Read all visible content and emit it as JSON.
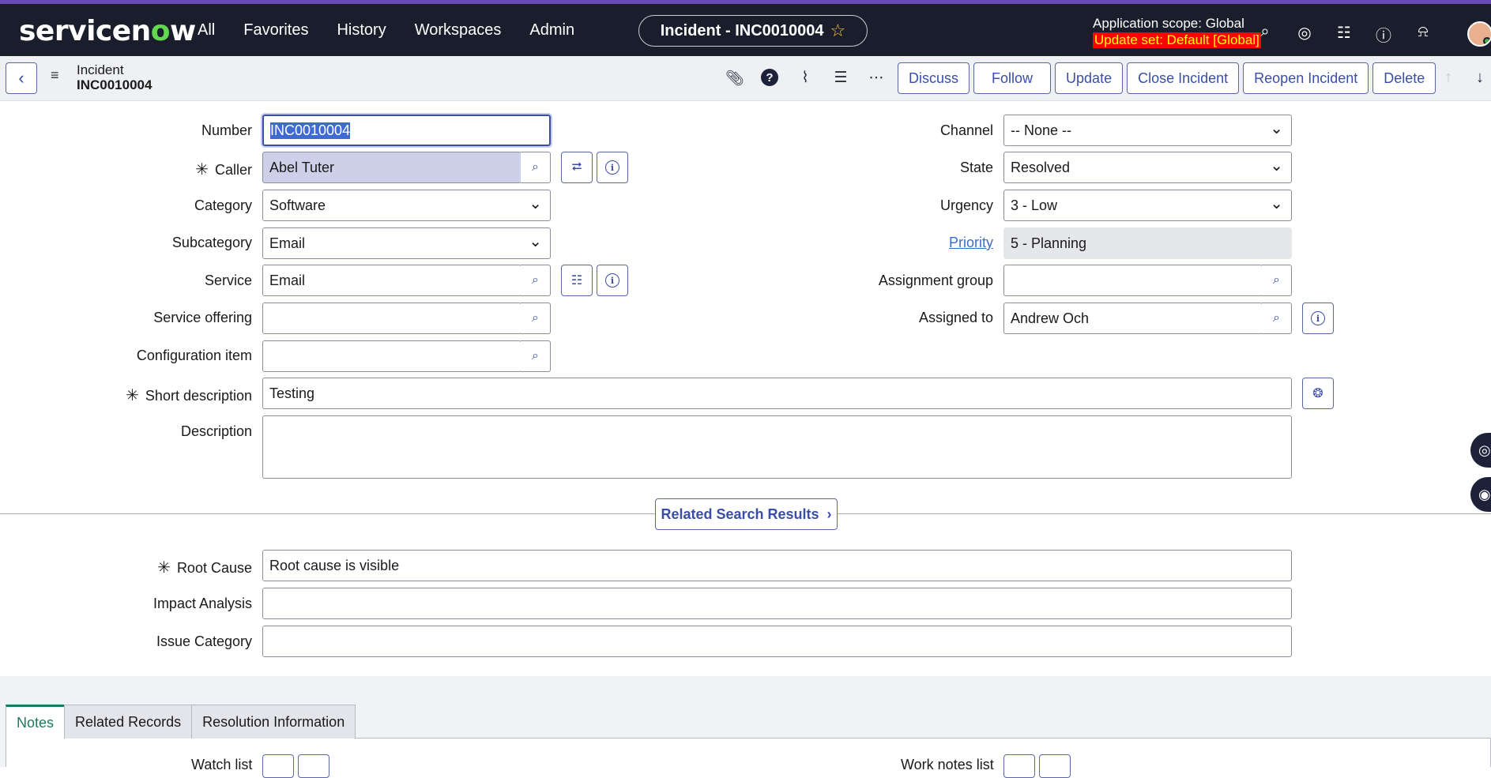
{
  "top_nav": {
    "logo_text_a": "servicen",
    "logo_text_o": "o",
    "logo_text_b": "w",
    "links": [
      "All",
      "Favorites",
      "History",
      "Workspaces",
      "Admin"
    ],
    "context_title": "Incident - INC0010004",
    "scope_line": "Application scope: Global",
    "update_set_line": "Update set: Default [Global]",
    "icons": [
      "search-icon",
      "globe-icon",
      "chat-icon",
      "help-icon",
      "bell-icon"
    ]
  },
  "form_header": {
    "table": "Incident",
    "number": "INC0010004",
    "icons": [
      "paperclip-icon",
      "help-icon",
      "activity-icon",
      "settings-sliders-icon",
      "more-icon"
    ],
    "buttons": [
      "Discuss",
      "Follow",
      "Update",
      "Close Incident",
      "Reopen Incident",
      "Delete"
    ]
  },
  "form": {
    "left": {
      "number": {
        "label": "Number",
        "value": "INC0010004"
      },
      "caller": {
        "label": "Caller",
        "value": "Abel Tuter"
      },
      "category": {
        "label": "Category",
        "value": "Software"
      },
      "subcategory": {
        "label": "Subcategory",
        "value": "Email"
      },
      "service": {
        "label": "Service",
        "value": "Email"
      },
      "service_offering": {
        "label": "Service offering",
        "value": ""
      },
      "configuration_item": {
        "label": "Configuration item",
        "value": ""
      }
    },
    "right": {
      "channel": {
        "label": "Channel",
        "value": "-- None --"
      },
      "state": {
        "label": "State",
        "value": "Resolved"
      },
      "urgency": {
        "label": "Urgency",
        "value": "3 - Low"
      },
      "priority": {
        "label": "Priority",
        "value": "5 - Planning"
      },
      "assignment_group": {
        "label": "Assignment group",
        "value": ""
      },
      "assigned_to": {
        "label": "Assigned to",
        "value": "Andrew Och"
      }
    },
    "short_description": {
      "label": "Short description",
      "value": "Testing"
    },
    "description": {
      "label": "Description",
      "value": ""
    },
    "related_search_button": "Related Search Results",
    "root_cause": {
      "label": "Root Cause",
      "value": "Root cause is visible"
    },
    "impact_analysis": {
      "label": "Impact Analysis",
      "value": ""
    },
    "issue_category": {
      "label": "Issue Category",
      "value": ""
    }
  },
  "tabs": [
    "Notes",
    "Related Records",
    "Resolution Information"
  ],
  "notes": {
    "watch_list": "Watch list",
    "work_notes_list": "Work notes list"
  },
  "colors": {
    "nav_bg": "#1a1d2b",
    "accent": "#3a4ea8",
    "active_tab": "#1c7a5b",
    "update_set_bg": "#ff0000",
    "update_set_fg": "#ffff00"
  }
}
